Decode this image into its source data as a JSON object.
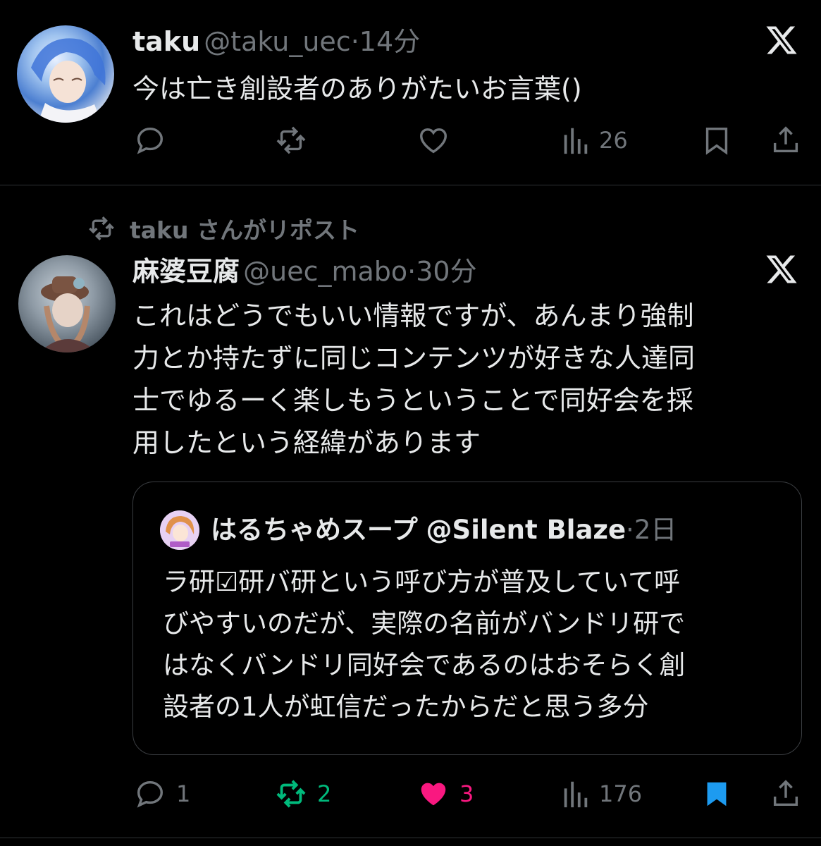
{
  "tweet1": {
    "display_name": "taku",
    "handle": "@taku_uec",
    "separator": "·",
    "time": "14分",
    "text": "今は亡き創設者のありがたいお言葉()",
    "views": "26"
  },
  "repost_banner": {
    "label": "taku さんがリポスト"
  },
  "tweet2": {
    "display_name": "麻婆豆腐",
    "handle": "@uec_mabo",
    "separator": "·",
    "time": "30分",
    "text_lines": [
      "これはどうでもいい情報ですが、あんまり強制",
      "力とか持たずに同じコンテンツが好きな人達同",
      "士でゆるーく楽しもうということで同好会を採",
      "用したという経緯があります"
    ],
    "replies": "1",
    "reposts": "2",
    "likes": "3",
    "views": "176"
  },
  "quoted": {
    "display_name": "はるちゃめスープ",
    "handle": "@Silent Blaze",
    "separator": "·",
    "time": "2日",
    "text_lines": [
      "ラ研☑研バ研という呼び方が普及していて呼",
      "びやすいのだが、実際の名前がバンドリ研で",
      "はなくバンドリ同好会であるのはおそらく創",
      "設者の1人が虹信だったからだと思う多分"
    ]
  },
  "colors": {
    "background": "#000000",
    "text_primary": "#e7e9ea",
    "text_secondary": "#71767b",
    "repost_green": "#00ba7c",
    "like_pink": "#f91880",
    "bookmark_blue": "#1d9bf0"
  },
  "icons": [
    "x-logo-icon",
    "reply-icon",
    "repost-icon",
    "like-icon",
    "views-icon",
    "bookmark-icon",
    "share-icon"
  ]
}
